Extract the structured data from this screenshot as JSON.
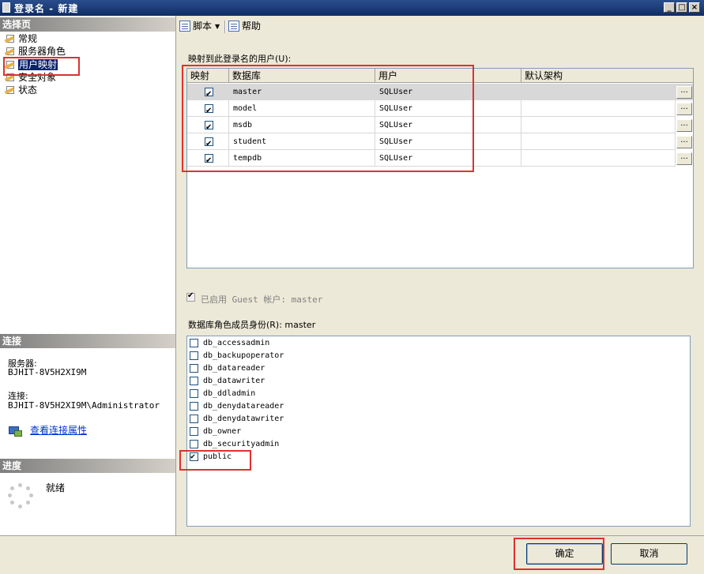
{
  "window": {
    "title": "登录名 - 新建"
  },
  "left": {
    "select_page_header": "选择页",
    "nav_items": [
      {
        "label": "常规"
      },
      {
        "label": "服务器角色"
      },
      {
        "label": "用户映射"
      },
      {
        "label": "安全对象"
      },
      {
        "label": "状态"
      }
    ],
    "connection": {
      "header": "连接",
      "server_label": "服务器:",
      "server_value": "BJHIT-8V5H2XI9M",
      "conn_label": "连接:",
      "conn_value": "BJHIT-8V5H2XI9M\\Administrator",
      "link": "查看连接属性"
    },
    "progress": {
      "header": "进度",
      "status": "就绪"
    }
  },
  "toolbar": {
    "script_label": "脚本",
    "help_label": "帮助"
  },
  "mapping": {
    "label": "映射到此登录名的用户(U):",
    "columns": [
      "映射",
      "数据库",
      "用户",
      "默认架构"
    ],
    "rows": [
      {
        "mapped": true,
        "database": "master",
        "user": "SQLUser",
        "schema": ""
      },
      {
        "mapped": true,
        "database": "model",
        "user": "SQLUser",
        "schema": ""
      },
      {
        "mapped": true,
        "database": "msdb",
        "user": "SQLUser",
        "schema": ""
      },
      {
        "mapped": true,
        "database": "student",
        "user": "SQLUser",
        "schema": ""
      },
      {
        "mapped": true,
        "database": "tempdb",
        "user": "SQLUser",
        "schema": ""
      }
    ],
    "ellipsis": "..."
  },
  "guest": {
    "label": "已启用 Guest 帐户: master",
    "checked": true
  },
  "roles": {
    "label": "数据库角色成员身份(R): master",
    "items": [
      {
        "name": "db_accessadmin",
        "checked": false
      },
      {
        "name": "db_backupoperator",
        "checked": false
      },
      {
        "name": "db_datareader",
        "checked": false
      },
      {
        "name": "db_datawriter",
        "checked": false
      },
      {
        "name": "db_ddladmin",
        "checked": false
      },
      {
        "name": "db_denydatareader",
        "checked": false
      },
      {
        "name": "db_denydatawriter",
        "checked": false
      },
      {
        "name": "db_owner",
        "checked": false
      },
      {
        "name": "db_securityadmin",
        "checked": false
      },
      {
        "name": "public",
        "checked": true
      }
    ]
  },
  "buttons": {
    "ok": "确定",
    "cancel": "取消"
  },
  "colors": {
    "highlight": "#e03030",
    "selection": "#0a246a",
    "titlebar": "#0f2d66"
  }
}
